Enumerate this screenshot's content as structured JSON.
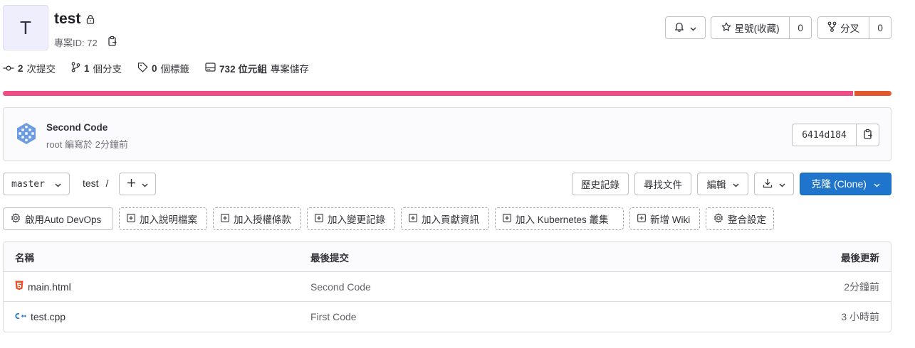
{
  "project": {
    "avatar_letter": "T",
    "name": "test",
    "id_label": "專案ID: 72"
  },
  "header_actions": {
    "star_label": "星號(收藏)",
    "star_count": "0",
    "fork_label": "分叉",
    "fork_count": "0"
  },
  "stats": {
    "commits_count": "2",
    "commits_label": "次提交",
    "branches_count": "1",
    "branches_label": "個分支",
    "tags_count": "0",
    "tags_label": "個標籤",
    "storage_size": "732 位元組",
    "storage_label": "專案儲存"
  },
  "languages": [
    {
      "fraction": 0.958,
      "color": "#ed4c84"
    },
    {
      "fraction": 0.042,
      "color": "#e2572d"
    }
  ],
  "last_commit": {
    "title": "Second Code",
    "meta": "root 編寫於 2分鐘前",
    "sha": "6414d184"
  },
  "nav": {
    "branch": "master",
    "path": "test",
    "separator": "/",
    "history": "歷史記錄",
    "find_file": "尋找文件",
    "edit": "編輯",
    "clone": "克隆 (Clone)"
  },
  "quick_actions": {
    "auto_devops": "啟用Auto DevOps",
    "readme": "加入說明檔案",
    "license": "加入授權條款",
    "changelog": "加入變更記錄",
    "contributing": "加入貢獻資訊",
    "kubernetes": "加入 Kubernetes 叢集",
    "wiki": "新增 Wiki",
    "integrations": "整合設定"
  },
  "table": {
    "headers": {
      "name": "名稱",
      "last_commit": "最後提交",
      "last_update": "最後更新"
    },
    "rows": [
      {
        "name": "main.html",
        "commit": "Second Code",
        "updated": "2分鐘前",
        "icon": "html5-icon"
      },
      {
        "name": "test.cpp",
        "commit": "First Code",
        "updated": "3 小時前",
        "icon": "cpp-icon"
      }
    ]
  },
  "colors": {
    "primary": "#1f75cb",
    "html_icon": "#e34f26",
    "cpp_icon": "#1a73c8"
  }
}
